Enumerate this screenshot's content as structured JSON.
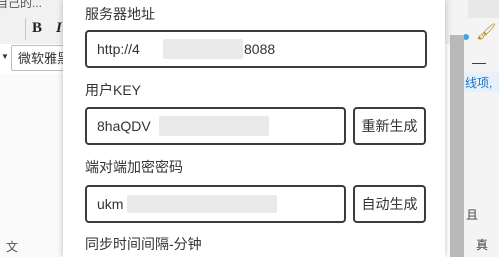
{
  "background": {
    "window_title_fragment": "自己的...",
    "toolbar": {
      "bold_label": "B",
      "italic_label": "I"
    },
    "font_select_value": "微软雅黑",
    "right_panel_text": "线项,",
    "right_panel_text2": "真",
    "right_panel_text3": "且",
    "bottom_text": "文"
  },
  "form": {
    "server": {
      "label": "服务器地址",
      "value_prefix": "http://4",
      "value_suffix": "8088"
    },
    "user_key": {
      "label": "用户KEY",
      "value": "8haQDV",
      "button_label": "重新生成"
    },
    "e2e_password": {
      "label": "端对端加密密码",
      "value": "ukm",
      "button_label": "自动生成"
    },
    "sync_interval": {
      "label": "同步时间间隔-分钟"
    }
  }
}
